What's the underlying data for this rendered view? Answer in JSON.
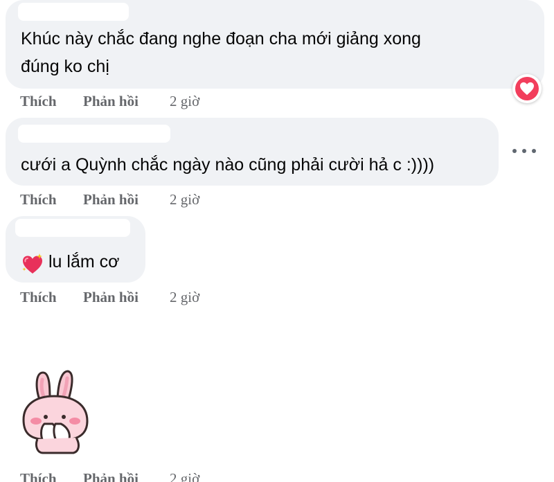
{
  "comments": [
    {
      "text_lines": [
        "Khúc này chắc đang nghe đoạn cha mới giảng xong",
        "đúng ko chị"
      ],
      "actions": {
        "like": "Thích",
        "reply": "Phản hồi",
        "time": "2 giờ"
      },
      "reaction": "heart-icon"
    },
    {
      "text_lines": [
        "cưới a Quỳnh chắc ngày nào cũng phải cười hả c :))))"
      ],
      "actions": {
        "like": "Thích",
        "reply": "Phản hồi",
        "time": "2 giờ"
      },
      "menu_icon": "more-options-icon"
    },
    {
      "emoji": "sparkling-heart-icon",
      "text_lines": [
        "lu lắm cơ"
      ],
      "actions": {
        "like": "Thích",
        "reply": "Phản hồi",
        "time": "2 giờ"
      }
    },
    {
      "sticker": "pink-bunny-sticker",
      "actions": {
        "like": "Thích",
        "reply": "Phản hồi",
        "time": "2 giờ"
      }
    }
  ],
  "colors": {
    "bubble": "#f0f2f5",
    "text": "#050505",
    "secondary_text": "#65676b",
    "reaction_heart": "#f23e5c"
  }
}
